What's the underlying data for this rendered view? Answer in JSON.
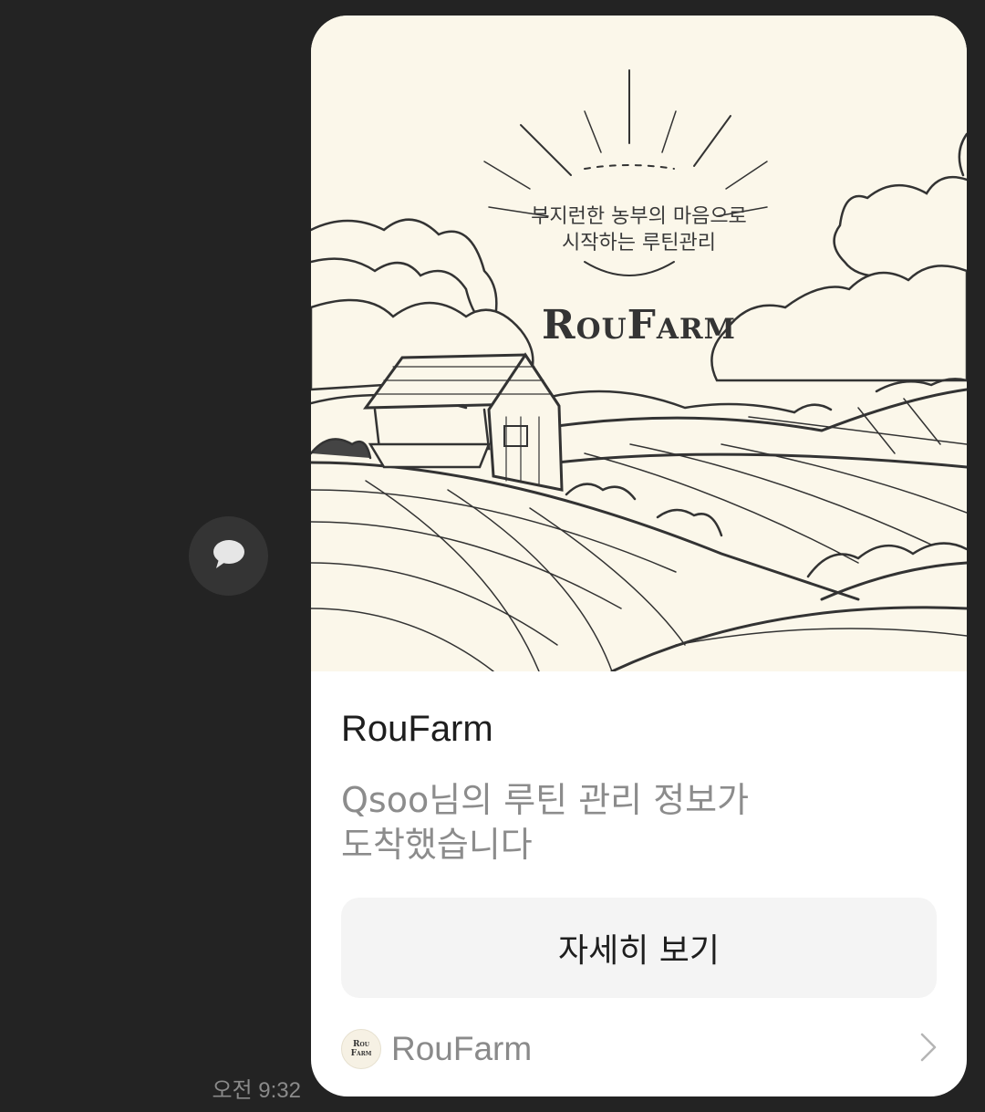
{
  "message": {
    "time": "오전 9:32"
  },
  "card": {
    "hero": {
      "tagline_line1": "부지런한 농부의 마음으로",
      "tagline_line2": "시작하는 루틴관리",
      "logo_text": "RouFarm"
    },
    "title": "RouFarm",
    "description_line1": "Qsoo님의 루틴 관리 정보가",
    "description_line2": "도착했습니다",
    "button_label": "자세히 보기",
    "channel": {
      "logo_line1": "Rou",
      "logo_line2": "Farm",
      "name": "RouFarm"
    }
  },
  "icons": {
    "share": "speech-bubble-icon",
    "chevron": "chevron-right-icon"
  },
  "colors": {
    "background": "#232323",
    "card": "#ffffff",
    "hero_bg": "#fbf7ea",
    "button_bg": "#f4f4f4"
  }
}
